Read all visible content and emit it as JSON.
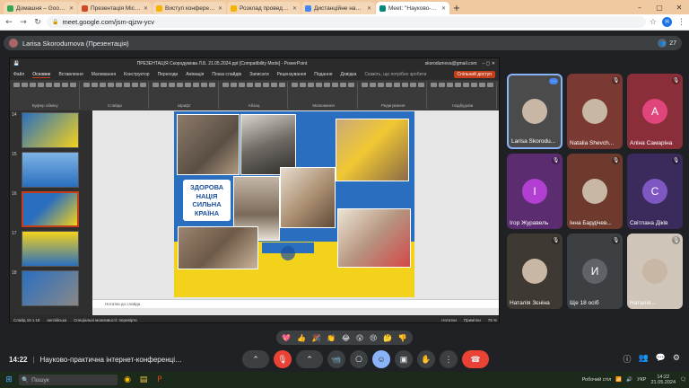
{
  "browser": {
    "tabs": [
      {
        "title": "Домашня – Google Диск",
        "color": "#34a853"
      },
      {
        "title": "Презентація Microsoft PowerPoint",
        "color": "#d24726"
      },
      {
        "title": "Виступ конференція .pptx - Goo",
        "color": "#f4b400"
      },
      {
        "title": "Розклад проведення конференції",
        "color": "#f4b400"
      },
      {
        "title": "Дистанційне навчання в ВСП",
        "color": "#4285f4"
      },
      {
        "title": "Meet: \"Науково-практичн",
        "color": "#00897b",
        "active": true
      }
    ],
    "new_tab": "+",
    "url": "meet.google.com/jsm-qjzw-ycv",
    "profile": "H"
  },
  "meet": {
    "presenter": "Larisa Skorodumova (Презентація)",
    "participants_count": "27",
    "time": "14:22",
    "meeting_title": "Науково-практична інтернет-конференція «ОСВІ...",
    "reactions": [
      "💖",
      "👍",
      "🎉",
      "👏",
      "😂",
      "😮",
      "😢",
      "🤔",
      "👎"
    ]
  },
  "ppt": {
    "title": "ПРЕЗЕНТАЦІЯ Скородумова Л.Б. 21.05.2024.ppt [Compatibility Mode] - PowerPoint",
    "account": "skorodumova@gmail.com",
    "menu": [
      "Файл",
      "Основне",
      "Вставлення",
      "Малювання",
      "Конструктор",
      "Переходи",
      "Анімація",
      "Показ слайдів",
      "Записати",
      "Рецензування",
      "Подання",
      "Довідка"
    ],
    "active_menu": "Основне",
    "search_placeholder": "Скажіть, що потрібно зробити",
    "share": "Спільний доступ",
    "ribbon_groups": [
      "Буфер обміну",
      "Слайди",
      "Шрифт",
      "Абзац",
      "Малювання",
      "Редагування",
      "Надбудови"
    ],
    "thumbs": [
      {
        "num": "14"
      },
      {
        "num": "15"
      },
      {
        "num": "16",
        "selected": true
      },
      {
        "num": "17"
      },
      {
        "num": "18"
      }
    ],
    "slide_text": {
      "line1": "ЗДОРОВА",
      "line2": "НАЦІЯ",
      "line3": "СИЛЬНА",
      "line4": "КРАЇНА"
    },
    "notes_placeholder": "Нотатки до слайда",
    "status": {
      "slide": "Слайд 16 з 18",
      "lang": "англійська",
      "accessibility": "Спеціальні можливості: перевірте",
      "notes": "Нотатки",
      "comments": "Примітки",
      "zoom": "76 %"
    }
  },
  "participants": [
    {
      "name": "Larisa Skorodu...",
      "type": "video",
      "color": "#4b4b4b"
    },
    {
      "name": "Natalia Shevch...",
      "type": "photo",
      "color": "#7a3a33"
    },
    {
      "name": "Аліна Самаріна",
      "type": "letter",
      "letter": "A",
      "color": "#8a2f3a",
      "avatar_color": "#e0457b"
    },
    {
      "name": "Ігор Журавель",
      "type": "letter",
      "letter": "I",
      "color": "#5b2c6f",
      "avatar_color": "#b23fd1"
    },
    {
      "name": "Інна Бардічев...",
      "type": "video",
      "color": "#6e3a2e"
    },
    {
      "name": "Світлана Діків",
      "type": "letter",
      "letter": "C",
      "color": "#3b2a5c",
      "avatar_color": "#7e57c2"
    },
    {
      "name": "Наталія Зєніна",
      "type": "photo",
      "color": "#3e3a33"
    },
    {
      "name": "Ще 18 осіб",
      "type": "group",
      "letter": "И",
      "color": "#3c4043"
    },
    {
      "name": "Наталія...",
      "type": "video",
      "color": "#cfc5b8"
    }
  ],
  "taskbar": {
    "search": "Пошук",
    "weather": "Робочий стіл",
    "lang": "УКР",
    "time": "14:22",
    "date": "21.05.2024"
  }
}
